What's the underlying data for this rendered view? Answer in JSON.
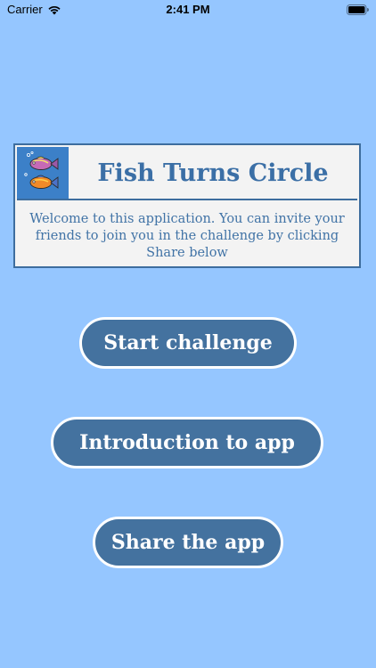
{
  "status_bar": {
    "carrier": "Carrier",
    "time": "2:41 PM",
    "wifi_icon": "wifi-icon",
    "battery_icon": "battery-full-icon"
  },
  "header": {
    "title": "Fish Turns Circle",
    "icon": "two-fish-icon",
    "welcome_text": "Welcome to this application. You can invite your friends to join you in the challenge by clicking Share below"
  },
  "buttons": {
    "start": "Start challenge",
    "intro": "Introduction to app",
    "share": "Share the app"
  },
  "colors": {
    "background": "#95c6ff",
    "button_fill": "#44729f",
    "button_border": "#ffffff",
    "title_text": "#3b6fa6",
    "card_background": "#f3f3f3",
    "icon_background": "#3c80c8"
  }
}
